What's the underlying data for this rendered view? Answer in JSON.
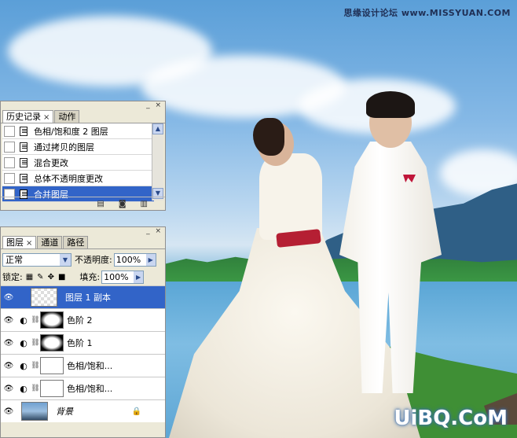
{
  "watermark_top": "思缘设计论坛 www.MISSYUAN.COM",
  "watermark_bottom": "UiBQ.CoM",
  "history_panel": {
    "tabs": [
      {
        "label": "历史记录",
        "close": "×"
      },
      {
        "label": "动作"
      }
    ],
    "items": [
      {
        "label": "色相/饱和度 2 图层"
      },
      {
        "label": "通过拷贝的图层"
      },
      {
        "label": "混合更改"
      },
      {
        "label": "总体不透明度更改"
      },
      {
        "label": "合并图层"
      }
    ],
    "selected_index": 4,
    "controls": "_ ×",
    "footer_icons": [
      "new-document-icon",
      "camera-snapshot-icon",
      "trash-icon"
    ]
  },
  "layers_panel": {
    "tabs": [
      {
        "label": "图层",
        "close": "×"
      },
      {
        "label": "通道"
      },
      {
        "label": "路径"
      }
    ],
    "controls": "_ ×",
    "blend_mode": "正常",
    "opacity_label": "不透明度:",
    "opacity_value": "100%",
    "lock_label": "锁定:",
    "fill_label": "填充:",
    "fill_value": "100%",
    "layers": [
      {
        "name": "图层 1 副本",
        "type": "pixel",
        "selected": true
      },
      {
        "name": "色阶 2",
        "type": "adjustment",
        "mask": "white-center"
      },
      {
        "name": "色阶 1",
        "type": "adjustment",
        "mask": "white-center"
      },
      {
        "name": "色相/饱和...",
        "type": "adjustment",
        "mask": "white"
      },
      {
        "name": "色相/饱和...",
        "type": "adjustment",
        "mask": "white"
      },
      {
        "name": "背景",
        "type": "background",
        "locked": true
      }
    ]
  },
  "colors": {
    "selection": "#3264c8",
    "panel_bg": "#ece9d8"
  }
}
